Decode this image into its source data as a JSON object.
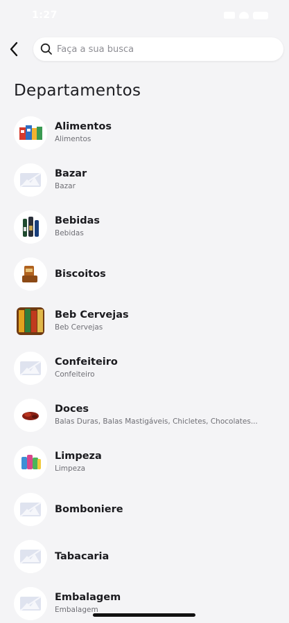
{
  "status_bar": {
    "time": "1:27"
  },
  "header": {
    "search_placeholder": "Faça a sua busca"
  },
  "page_title": "Departamentos",
  "departments": [
    {
      "name": "Alimentos",
      "subtitle": "Alimentos",
      "thumb": "alimentos-image"
    },
    {
      "name": "Bazar",
      "subtitle": "Bazar",
      "thumb": "placeholder-image-icon"
    },
    {
      "name": "Bebidas",
      "subtitle": "Bebidas",
      "thumb": "bebidas-image"
    },
    {
      "name": "Biscoitos",
      "subtitle": "",
      "thumb": "biscoitos-image"
    },
    {
      "name": "Beb Cervejas",
      "subtitle": "Beb Cervejas",
      "thumb": "cervejas-image"
    },
    {
      "name": "Confeiteiro",
      "subtitle": "Confeiteiro",
      "thumb": "placeholder-image-icon"
    },
    {
      "name": "Doces",
      "subtitle": "Balas Duras, Balas Mastigáveis, Chicletes, Chocolates...",
      "thumb": "doces-image"
    },
    {
      "name": "Limpeza",
      "subtitle": "Limpeza",
      "thumb": "limpeza-image"
    },
    {
      "name": "Bomboniere",
      "subtitle": "",
      "thumb": "placeholder-image-icon"
    },
    {
      "name": "Tabacaria",
      "subtitle": "",
      "thumb": "placeholder-image-icon"
    },
    {
      "name": "Embalagem",
      "subtitle": "Embalagem",
      "thumb": "placeholder-image-icon"
    }
  ],
  "colors": {
    "background": "#f4f4f6",
    "card": "#ffffff",
    "text_primary": "#1b1b1f",
    "text_secondary": "#6e6e74",
    "placeholder_icon": "#cfd4e6"
  }
}
